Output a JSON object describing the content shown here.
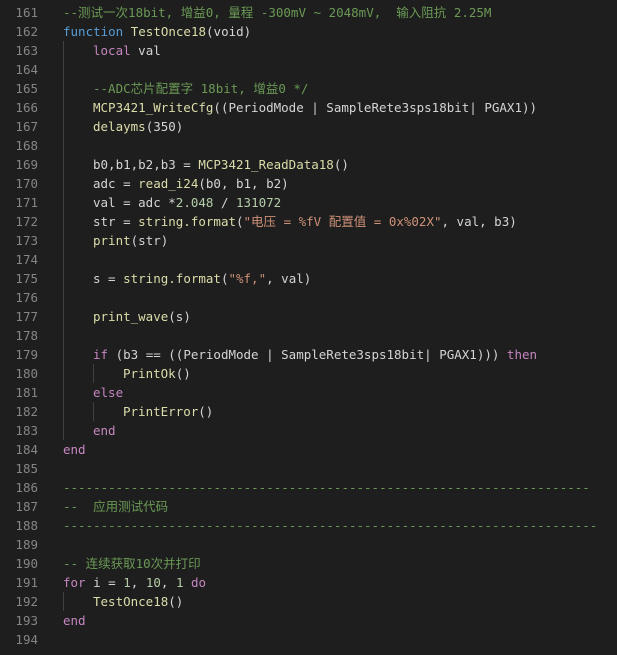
{
  "editor": {
    "colors": {
      "background": "#1e1e1e",
      "line_number": "#858585",
      "keyword": "#c586c0",
      "keyword_blue": "#569cd6",
      "function": "#dcdcaa",
      "string": "#ce9178",
      "number": "#b5cea8",
      "comment": "#6a9955",
      "text": "#d4d4d4"
    },
    "lines": [
      {
        "n": "161",
        "indent": 0,
        "tokens": [
          {
            "t": "--测试一次18bit, 增益0, 量程 -300mV ~ 2048mV,  输入阻抗 2.25M",
            "c": "cm"
          }
        ]
      },
      {
        "n": "162",
        "indent": 0,
        "tokens": [
          {
            "t": "function",
            "c": "kwb"
          },
          {
            "t": " ",
            "c": "pl"
          },
          {
            "t": "TestOnce18",
            "c": "fn"
          },
          {
            "t": "(void)",
            "c": "pl"
          }
        ]
      },
      {
        "n": "163",
        "indent": 1,
        "tokens": [
          {
            "t": "local",
            "c": "kw"
          },
          {
            "t": " val",
            "c": "pl"
          }
        ]
      },
      {
        "n": "164",
        "indent": 1,
        "tokens": []
      },
      {
        "n": "165",
        "indent": 1,
        "tokens": [
          {
            "t": "--ADC芯片配置字 18bit, 增益0 */",
            "c": "cm"
          }
        ]
      },
      {
        "n": "166",
        "indent": 1,
        "tokens": [
          {
            "t": "MCP3421_WriteCfg",
            "c": "fn"
          },
          {
            "t": "((PeriodMode | SampleRete3sps18bit| PGAX1))",
            "c": "pl"
          }
        ]
      },
      {
        "n": "167",
        "indent": 1,
        "tokens": [
          {
            "t": "delayms",
            "c": "fn"
          },
          {
            "t": "(350)",
            "c": "pl"
          }
        ]
      },
      {
        "n": "168",
        "indent": 1,
        "tokens": []
      },
      {
        "n": "169",
        "indent": 1,
        "tokens": [
          {
            "t": "b0,b1,b2,b3 = ",
            "c": "pl"
          },
          {
            "t": "MCP3421_ReadData18",
            "c": "fn"
          },
          {
            "t": "()",
            "c": "pl"
          }
        ]
      },
      {
        "n": "170",
        "indent": 1,
        "tokens": [
          {
            "t": "adc = ",
            "c": "pl"
          },
          {
            "t": "read_i24",
            "c": "fn"
          },
          {
            "t": "(b0, b1, b2)",
            "c": "pl"
          }
        ]
      },
      {
        "n": "171",
        "indent": 1,
        "tokens": [
          {
            "t": "val = adc *",
            "c": "pl"
          },
          {
            "t": "2.048",
            "c": "num"
          },
          {
            "t": " / ",
            "c": "pl"
          },
          {
            "t": "131072",
            "c": "num"
          }
        ]
      },
      {
        "n": "172",
        "indent": 1,
        "tokens": [
          {
            "t": "str = ",
            "c": "pl"
          },
          {
            "t": "string.format",
            "c": "fn"
          },
          {
            "t": "(",
            "c": "pl"
          },
          {
            "t": "\"电压 = %fV 配置值 = 0x%02X\"",
            "c": "str"
          },
          {
            "t": ", val, b3)",
            "c": "pl"
          }
        ]
      },
      {
        "n": "173",
        "indent": 1,
        "tokens": [
          {
            "t": "print",
            "c": "fn"
          },
          {
            "t": "(str)",
            "c": "pl"
          }
        ]
      },
      {
        "n": "174",
        "indent": 1,
        "tokens": []
      },
      {
        "n": "175",
        "indent": 1,
        "tokens": [
          {
            "t": "s = ",
            "c": "pl"
          },
          {
            "t": "string.format",
            "c": "fn"
          },
          {
            "t": "(",
            "c": "pl"
          },
          {
            "t": "\"%f,\"",
            "c": "str"
          },
          {
            "t": ", val)",
            "c": "pl"
          }
        ]
      },
      {
        "n": "176",
        "indent": 1,
        "tokens": []
      },
      {
        "n": "177",
        "indent": 1,
        "tokens": [
          {
            "t": "print_wave",
            "c": "fn"
          },
          {
            "t": "(s)",
            "c": "pl"
          }
        ]
      },
      {
        "n": "178",
        "indent": 1,
        "tokens": []
      },
      {
        "n": "179",
        "indent": 1,
        "tokens": [
          {
            "t": "if",
            "c": "kw"
          },
          {
            "t": " (b3 == ((PeriodMode | SampleRete3sps18bit| PGAX1))) ",
            "c": "pl"
          },
          {
            "t": "then",
            "c": "kw"
          }
        ]
      },
      {
        "n": "180",
        "indent": 2,
        "tokens": [
          {
            "t": "PrintOk",
            "c": "fn"
          },
          {
            "t": "()",
            "c": "pl"
          }
        ]
      },
      {
        "n": "181",
        "indent": 1,
        "tokens": [
          {
            "t": "else",
            "c": "kw"
          }
        ]
      },
      {
        "n": "182",
        "indent": 2,
        "tokens": [
          {
            "t": "PrintError",
            "c": "fn"
          },
          {
            "t": "()",
            "c": "pl"
          }
        ]
      },
      {
        "n": "183",
        "indent": 1,
        "tokens": [
          {
            "t": "end",
            "c": "kw"
          }
        ]
      },
      {
        "n": "184",
        "indent": 0,
        "tokens": [
          {
            "t": "end",
            "c": "kw"
          }
        ]
      },
      {
        "n": "185",
        "indent": 0,
        "tokens": []
      },
      {
        "n": "186",
        "indent": 0,
        "tokens": [
          {
            "t": "----------------------------------------------------------------------",
            "c": "cm"
          }
        ]
      },
      {
        "n": "187",
        "indent": 0,
        "tokens": [
          {
            "t": "--  应用测试代码",
            "c": "cm"
          }
        ]
      },
      {
        "n": "188",
        "indent": 0,
        "tokens": [
          {
            "t": "-----------------------------------------------------------------------",
            "c": "cm"
          }
        ]
      },
      {
        "n": "189",
        "indent": 0,
        "tokens": []
      },
      {
        "n": "190",
        "indent": 0,
        "tokens": [
          {
            "t": "-- 连续获取10次并打印",
            "c": "cm"
          }
        ]
      },
      {
        "n": "191",
        "indent": 0,
        "tokens": [
          {
            "t": "for",
            "c": "kw"
          },
          {
            "t": " i = ",
            "c": "pl"
          },
          {
            "t": "1",
            "c": "num"
          },
          {
            "t": ", ",
            "c": "pl"
          },
          {
            "t": "10",
            "c": "num"
          },
          {
            "t": ", ",
            "c": "pl"
          },
          {
            "t": "1",
            "c": "num"
          },
          {
            "t": " ",
            "c": "pl"
          },
          {
            "t": "do",
            "c": "kw"
          }
        ]
      },
      {
        "n": "192",
        "indent": 1,
        "tokens": [
          {
            "t": "TestOnce18",
            "c": "fn"
          },
          {
            "t": "()",
            "c": "pl"
          }
        ]
      },
      {
        "n": "193",
        "indent": 0,
        "tokens": [
          {
            "t": "end",
            "c": "kw"
          }
        ]
      },
      {
        "n": "194",
        "indent": 0,
        "tokens": []
      }
    ]
  }
}
